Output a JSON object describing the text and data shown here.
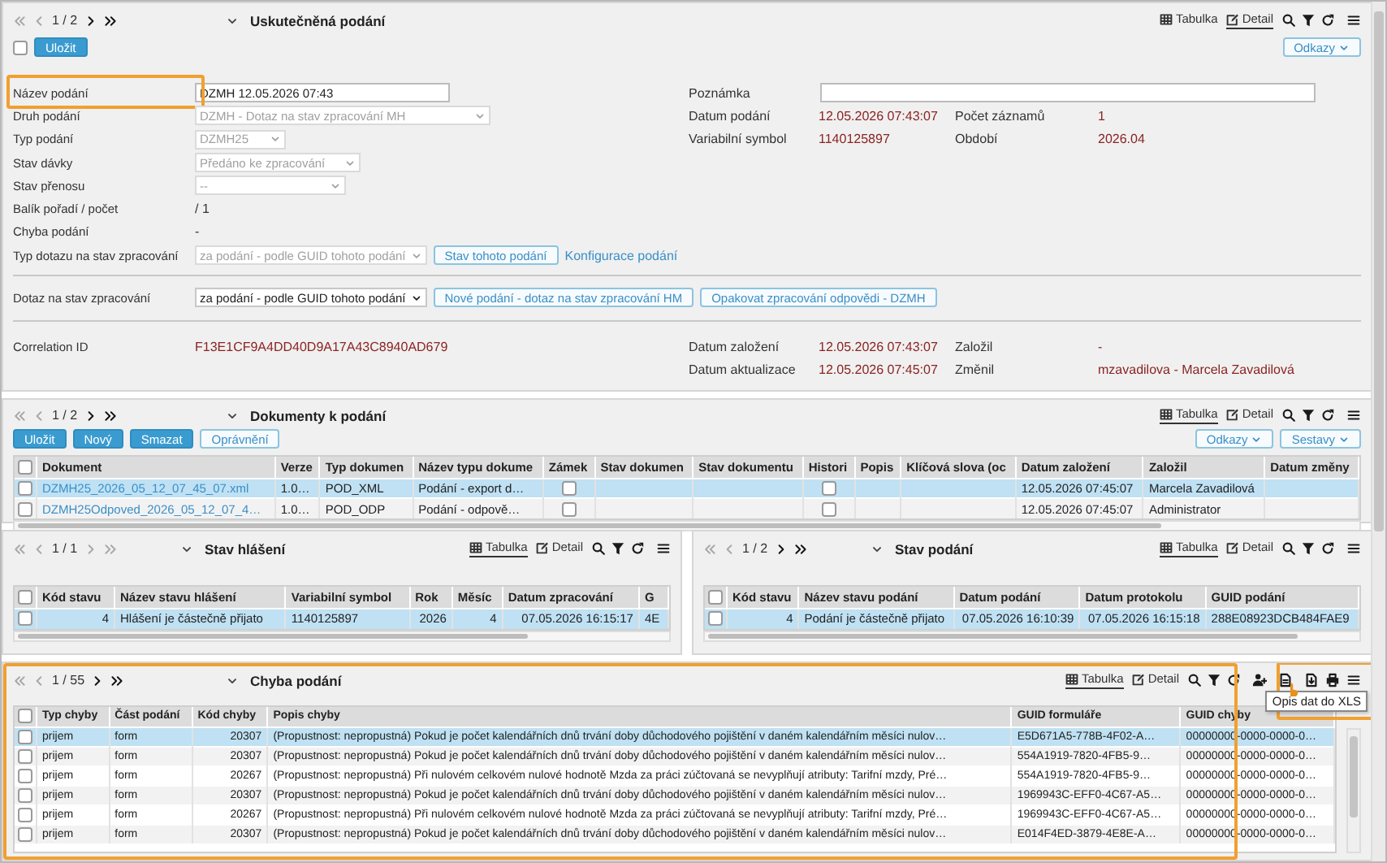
{
  "record_panel": {
    "pager": {
      "text": "1 / 2",
      "back_enabled": false,
      "forward_enabled": true
    },
    "title": "Uskutečněná podání",
    "views": [
      {
        "kind": "table",
        "label": "Tabulka",
        "selected": false
      },
      {
        "kind": "detail",
        "label": "Detail",
        "selected": true
      }
    ],
    "record_checked": false,
    "buttons": [
      {
        "kind": "primary",
        "label": "Uložit"
      }
    ],
    "menus": [
      {
        "label": "Odkazy"
      }
    ],
    "left_fields": [
      {
        "label": "Název podání",
        "kind": "input",
        "value": "DZMH 12.05.2026 07:43",
        "highlighted": true
      },
      {
        "label": "Druh podání",
        "kind": "select",
        "value": "DZMH - Dotaz na stav zpracování MH",
        "disabled": true
      },
      {
        "label": "Typ podání",
        "kind": "select",
        "value": "DZMH25",
        "disabled": true
      },
      {
        "label": "Stav dávky",
        "kind": "select",
        "value": "Předáno ke zpracování",
        "disabled": true
      },
      {
        "label": "Stav přenosu",
        "kind": "select",
        "value": "--",
        "disabled": true
      },
      {
        "label": "Balík pořadí / počet",
        "kind": "plain",
        "value": "/ 1"
      },
      {
        "label": "Chyba podání",
        "kind": "plain",
        "value": "-"
      },
      {
        "label": "Typ dotazu na stav zpracování",
        "kind": "select",
        "value": "za podání - podle GUID tohoto podání",
        "disabled": true,
        "actions": [
          {
            "kind": "button",
            "label": "Stav tohoto podání"
          },
          {
            "kind": "link",
            "label": "Konfigurace podání"
          }
        ]
      }
    ],
    "right_fields": [
      {
        "label": "Poznámka",
        "kind": "input"
      }
    ],
    "right_rows": [
      [
        {
          "label": "Datum podání",
          "value": "12.05.2026 07:43:07"
        },
        {
          "label": "Počet záznamů",
          "value": "1"
        }
      ],
      [
        {
          "label": "Variabilní symbol",
          "value": "1140125897"
        },
        {
          "label": "Období",
          "value": "2026.04"
        }
      ]
    ],
    "query_fields": [
      {
        "label": "Dotaz na stav zpracování",
        "kind": "select",
        "value": "za podání - podle GUID tohoto podání",
        "disabled": false,
        "actions": [
          {
            "kind": "button",
            "label": "Nové podání - dotaz na stav zpracování HM"
          },
          {
            "kind": "button",
            "label": "Opakovat zpracování odpovědi - DZMH"
          }
        ]
      }
    ],
    "audit_fields": [
      {
        "label": "Correlation ID",
        "kind": "text",
        "value": "F13E1CF9A4DD40D9A17A43C8940AD679"
      }
    ],
    "audit_rows": [
      [
        {
          "label": "Datum založení",
          "value": "12.05.2026 07:43:07"
        },
        {
          "label": "Založil",
          "value": "-"
        }
      ],
      [
        {
          "label": "Datum aktualizace",
          "value": "12.05.2026 07:45:07"
        },
        {
          "label": "Změnil",
          "value": "mzavadilova - Marcela Zavadilová"
        }
      ]
    ]
  },
  "documents_panel": {
    "pager": {
      "text": "1 / 2",
      "back_enabled": false,
      "forward_enabled": true
    },
    "title": "Dokumenty k podání",
    "views": [
      {
        "kind": "table",
        "label": "Tabulka",
        "selected": true
      },
      {
        "kind": "detail",
        "label": "Detail",
        "selected": false
      }
    ],
    "buttons": [
      {
        "kind": "primary",
        "label": "Uložit"
      },
      {
        "kind": "primary",
        "label": "Nový"
      },
      {
        "kind": "primary",
        "label": "Smazat"
      },
      {
        "kind": "secondary",
        "label": "Oprávnění"
      }
    ],
    "menus": [
      {
        "label": "Odkazy"
      },
      {
        "label": "Sestavy"
      }
    ],
    "table": {
      "all_checked": false,
      "columns": [
        {
          "label": "Dokument",
          "kind": "link"
        },
        {
          "label": "Verze",
          "kind": "text"
        },
        {
          "label": "Typ dokumen",
          "kind": "text"
        },
        {
          "label": "Název typu dokume",
          "kind": "text"
        },
        {
          "label": "Zámek",
          "kind": "check"
        },
        {
          "label": "Stav dokumen",
          "kind": "text"
        },
        {
          "label": "Stav dokumentu",
          "kind": "text"
        },
        {
          "label": "Histori",
          "kind": "check"
        },
        {
          "label": "Popis",
          "kind": "text"
        },
        {
          "label": "Klíčová slova (oc",
          "kind": "text"
        },
        {
          "label": "Datum založení",
          "kind": "text"
        },
        {
          "label": "Založil",
          "kind": "text"
        },
        {
          "label": "Datum změny",
          "kind": "text"
        }
      ],
      "rows": [
        {
          "selected": true,
          "checked": false,
          "cells": [
            "DZMH25_2026_05_12_07_45_07.xml",
            "1.0…",
            "POD_XML",
            "Podání - export d…",
            {
              "checked": false
            },
            null,
            null,
            {
              "checked": false
            },
            null,
            null,
            "12.05.2026 07:45:07",
            "Marcela Zavadilová",
            null
          ]
        },
        {
          "selected": false,
          "checked": false,
          "cells": [
            "DZMH25Odpoved_2026_05_12_07_4…",
            "1.0…",
            "POD_ODP",
            "Podání - odpově…",
            {
              "checked": false
            },
            null,
            null,
            {
              "checked": false
            },
            null,
            null,
            "12.05.2026 07:45:07",
            "Administrator",
            null
          ]
        }
      ]
    }
  },
  "report_status_panel": {
    "pager": {
      "text": "1 / 1",
      "back_enabled": false,
      "forward_enabled": false
    },
    "title": "Stav hlášení",
    "views": [
      {
        "kind": "table",
        "label": "Tabulka",
        "selected": true
      },
      {
        "kind": "detail",
        "label": "Detail",
        "selected": false
      }
    ],
    "table": {
      "all_checked": false,
      "columns": [
        {
          "label": "Kód stavu",
          "kind": "number"
        },
        {
          "label": "Název stavu hlášení",
          "kind": "text"
        },
        {
          "label": "Variabilní symbol",
          "kind": "text"
        },
        {
          "label": "Rok",
          "kind": "number"
        },
        {
          "label": "Měsíc",
          "kind": "number"
        },
        {
          "label": "Datum zpracování",
          "kind": "date"
        },
        {
          "label": "G",
          "kind": "text"
        }
      ],
      "rows": [
        {
          "selected": true,
          "checked": false,
          "cells": [
            "4",
            "Hlášení je částečně přijato",
            "1140125897",
            "2026",
            "4",
            "07.05.2026 16:15:17",
            "4E"
          ]
        }
      ]
    }
  },
  "submission_status_panel": {
    "pager": {
      "text": "1 / 2",
      "back_enabled": false,
      "forward_enabled": true
    },
    "title": "Stav podání",
    "views": [
      {
        "kind": "table",
        "label": "Tabulka",
        "selected": true
      },
      {
        "kind": "detail",
        "label": "Detail",
        "selected": false
      }
    ],
    "table": {
      "all_checked": false,
      "columns": [
        {
          "label": "Kód stavu",
          "kind": "number"
        },
        {
          "label": "Název stavu podání",
          "kind": "text"
        },
        {
          "label": "Datum podání",
          "kind": "date"
        },
        {
          "label": "Datum protokolu",
          "kind": "date"
        },
        {
          "label": "GUID podání",
          "kind": "text"
        }
      ],
      "rows": [
        {
          "selected": true,
          "checked": false,
          "cells": [
            "4",
            "Podání je částečně přijato",
            "07.05.2026 16:10:39",
            "07.05.2026 16:15:18",
            "288E08923DCB484FAE9"
          ]
        }
      ]
    }
  },
  "errors_panel": {
    "pager": {
      "text": "1 / 55",
      "back_enabled": false,
      "forward_enabled": true
    },
    "title": "Chyba podání",
    "highlighted": true,
    "views": [
      {
        "kind": "table",
        "label": "Tabulka",
        "selected": true
      },
      {
        "kind": "detail",
        "label": "Detail",
        "selected": false
      }
    ],
    "export_tools": true,
    "export_highlighted": true,
    "tooltip": "Opis dat do XLS",
    "table": {
      "all_checked": false,
      "columns": [
        {
          "label": "Typ chyby",
          "kind": "text"
        },
        {
          "label": "Část podání",
          "kind": "text"
        },
        {
          "label": "Kód chyby",
          "kind": "number"
        },
        {
          "label": "Popis chyby",
          "kind": "text"
        },
        {
          "label": "GUID formuláře",
          "kind": "text"
        },
        {
          "label": "GUID chyby",
          "kind": "text"
        }
      ],
      "rows": [
        {
          "selected": true,
          "checked": false,
          "cells": [
            "prijem",
            "form",
            "20307",
            "(Propustnost: nepropustná) Pokud je počet kalendářních dnů trvání doby důchodového pojištění v daném kalendářním měsíci nulov…",
            "E5D671A5-778B-4F02-A…",
            "00000000-0000-0000-0…"
          ]
        },
        {
          "selected": false,
          "checked": false,
          "cells": [
            "prijem",
            "form",
            "20307",
            "(Propustnost: nepropustná) Pokud je počet kalendářních dnů trvání doby důchodového pojištění v daném kalendářním měsíci nulov…",
            "554A1919-7820-4FB5-9…",
            "00000000-0000-0000-0…"
          ]
        },
        {
          "selected": false,
          "checked": false,
          "cells": [
            "prijem",
            "form",
            "20267",
            "(Propustnost: nepropustná) Při nulovém celkovém nulové hodnotě Mzda za práci zúčtovaná se nevyplňují atributy: Tarifní mzdy, Pré…",
            "554A1919-7820-4FB5-9…",
            "00000000-0000-0000-0…"
          ]
        },
        {
          "selected": false,
          "checked": false,
          "cells": [
            "prijem",
            "form",
            "20307",
            "(Propustnost: nepropustná) Pokud je počet kalendářních dnů trvání doby důchodového pojištění v daném kalendářním měsíci nulov…",
            "1969943C-EFF0-4C67-A5…",
            "00000000-0000-0000-0…"
          ]
        },
        {
          "selected": false,
          "checked": false,
          "cells": [
            "prijem",
            "form",
            "20267",
            "(Propustnost: nepropustná) Při nulovém celkovém nulové hodnotě Mzda za práci zúčtovaná se nevyplňují atributy: Tarifní mzdy, Pré…",
            "1969943C-EFF0-4C67-A5…",
            "00000000-0000-0000-0…"
          ]
        },
        {
          "selected": false,
          "checked": false,
          "cells": [
            "prijem",
            "form",
            "20307",
            "(Propustnost: nepropustná) Pokud je počet kalendářních dnů trvání doby důchodového pojištění v daném kalendářním měsíci nulov…",
            "E014F4ED-3879-4E8E-A…",
            "00000000-0000-0000-0…"
          ]
        }
      ]
    }
  }
}
